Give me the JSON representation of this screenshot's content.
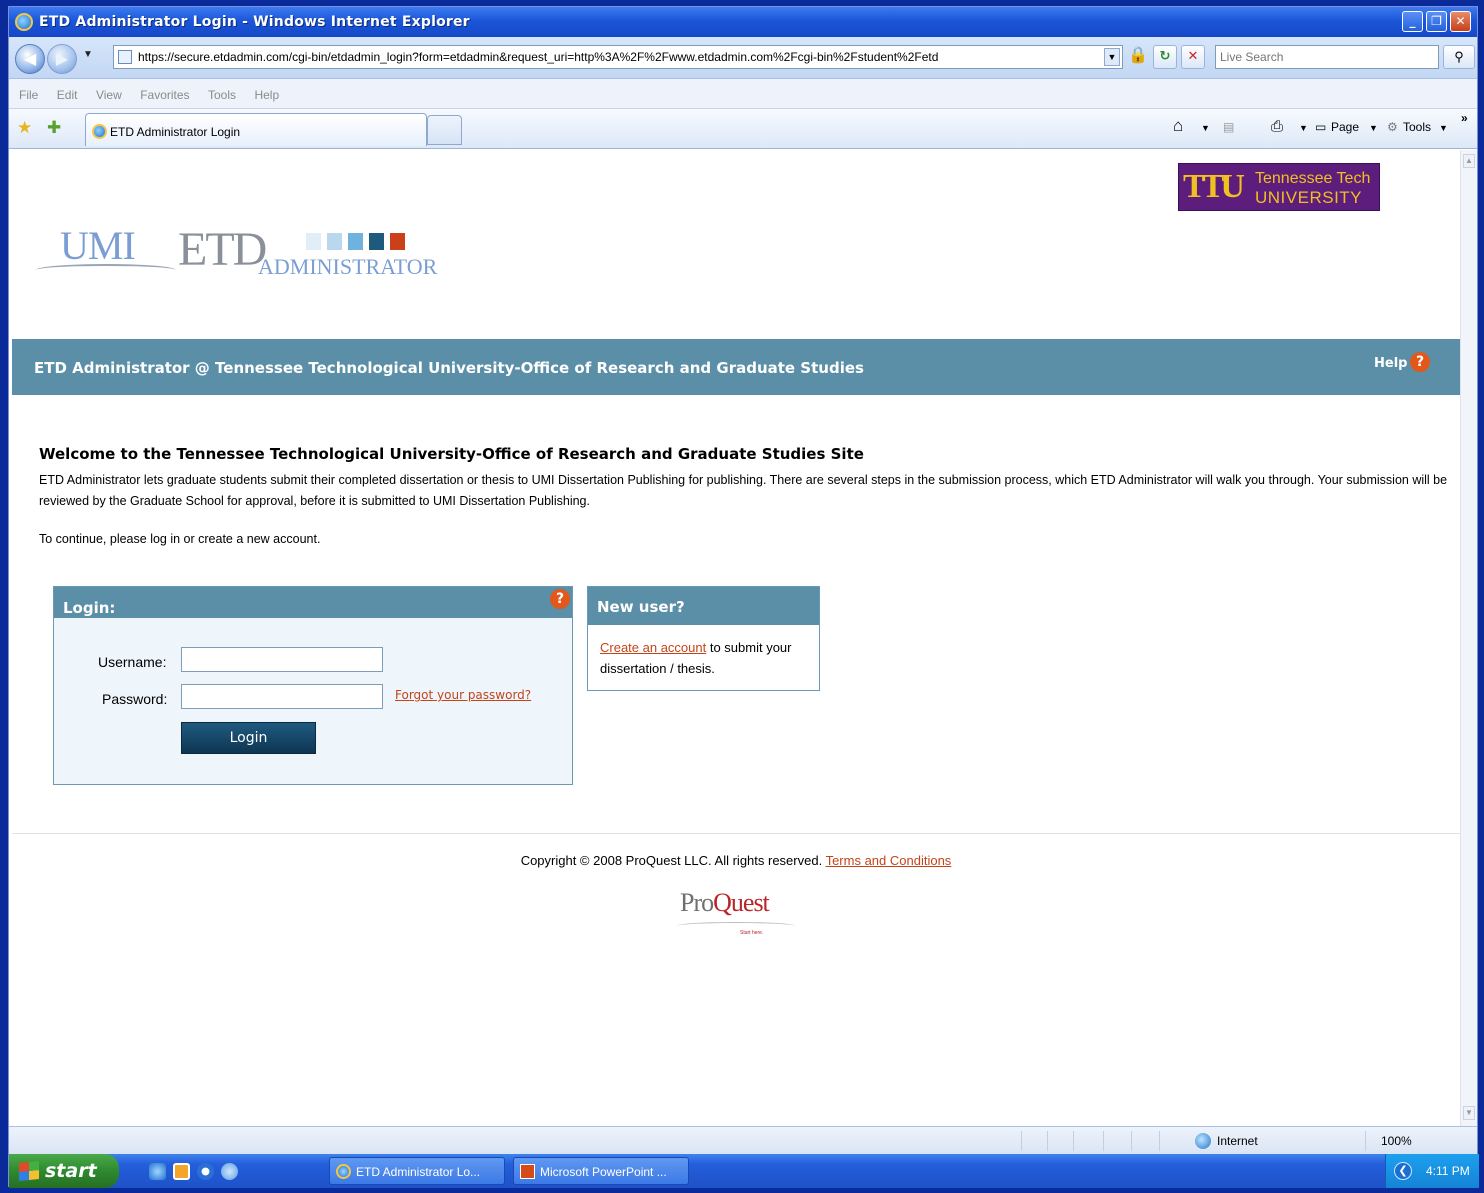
{
  "window": {
    "title": "ETD Administrator Login - Windows Internet Explorer",
    "minimize": "_",
    "restore": "❐",
    "close": "✕"
  },
  "addressbar": {
    "url": "https://secure.etdadmin.com/cgi-bin/etdadmin_login?form=etdadmin&request_uri=http%3A%2F%2Fwww.etdadmin.com%2Fcgi-bin%2Fstudent%2Fetd",
    "search_placeholder": "Live Search"
  },
  "menu": [
    "File",
    "Edit",
    "View",
    "Favorites",
    "Tools",
    "Help"
  ],
  "tabs": {
    "active_label": "ETD Administrator Login",
    "page_label": "Page",
    "tools_label": "Tools"
  },
  "page": {
    "partner_logo": {
      "line1": "Tennessee Tech",
      "line2": "UNIVERSITY"
    },
    "brand": {
      "umi": "UMI",
      "etd": "ETD",
      "admin": "ADMINISTRATOR"
    },
    "header_title": "ETD Administrator @ Tennessee Technological University-Office of Research and Graduate Studies",
    "help_label": "Help",
    "welcome_heading": "Welcome to the Tennessee Technological University-Office of Research and Graduate Studies Site",
    "welcome_text": "ETD Administrator lets graduate students submit their completed dissertation or thesis to UMI Dissertation Publishing for publishing. There are several steps in the submission process, which ETD Administrator will walk you through. Your submission will be reviewed by the Graduate School for approval, before it is submitted to UMI Dissertation Publishing.",
    "continue_text": "To continue, please log in or create a new account.",
    "login": {
      "heading": "Login:",
      "username_label": "Username:",
      "username_value": "",
      "password_label": "Password:",
      "password_value": "",
      "forgot_link": "Forgot your password?",
      "button": "Login"
    },
    "new_user": {
      "heading": "New user?",
      "create_link": "Create an account",
      "create_text": " to submit your dissertation / thesis."
    },
    "footer": {
      "copyright": "Copyright © 2008 ProQuest LLC. All rights reserved. ",
      "terms_link": "Terms and Conditions",
      "proquest_pro": "Pro",
      "proquest_quest": "Quest",
      "proquest_tagline": "Start here."
    }
  },
  "statusbar": {
    "zone": "Internet",
    "zoom": "100%"
  },
  "taskbar": {
    "start": "start",
    "items": [
      "ETD Administrator Lo...",
      "Microsoft PowerPoint ..."
    ],
    "clock": "4:11 PM"
  },
  "colors": {
    "header_bar": "#5b8fa8",
    "link": "#c4441a",
    "login_button": "#0e3652"
  }
}
